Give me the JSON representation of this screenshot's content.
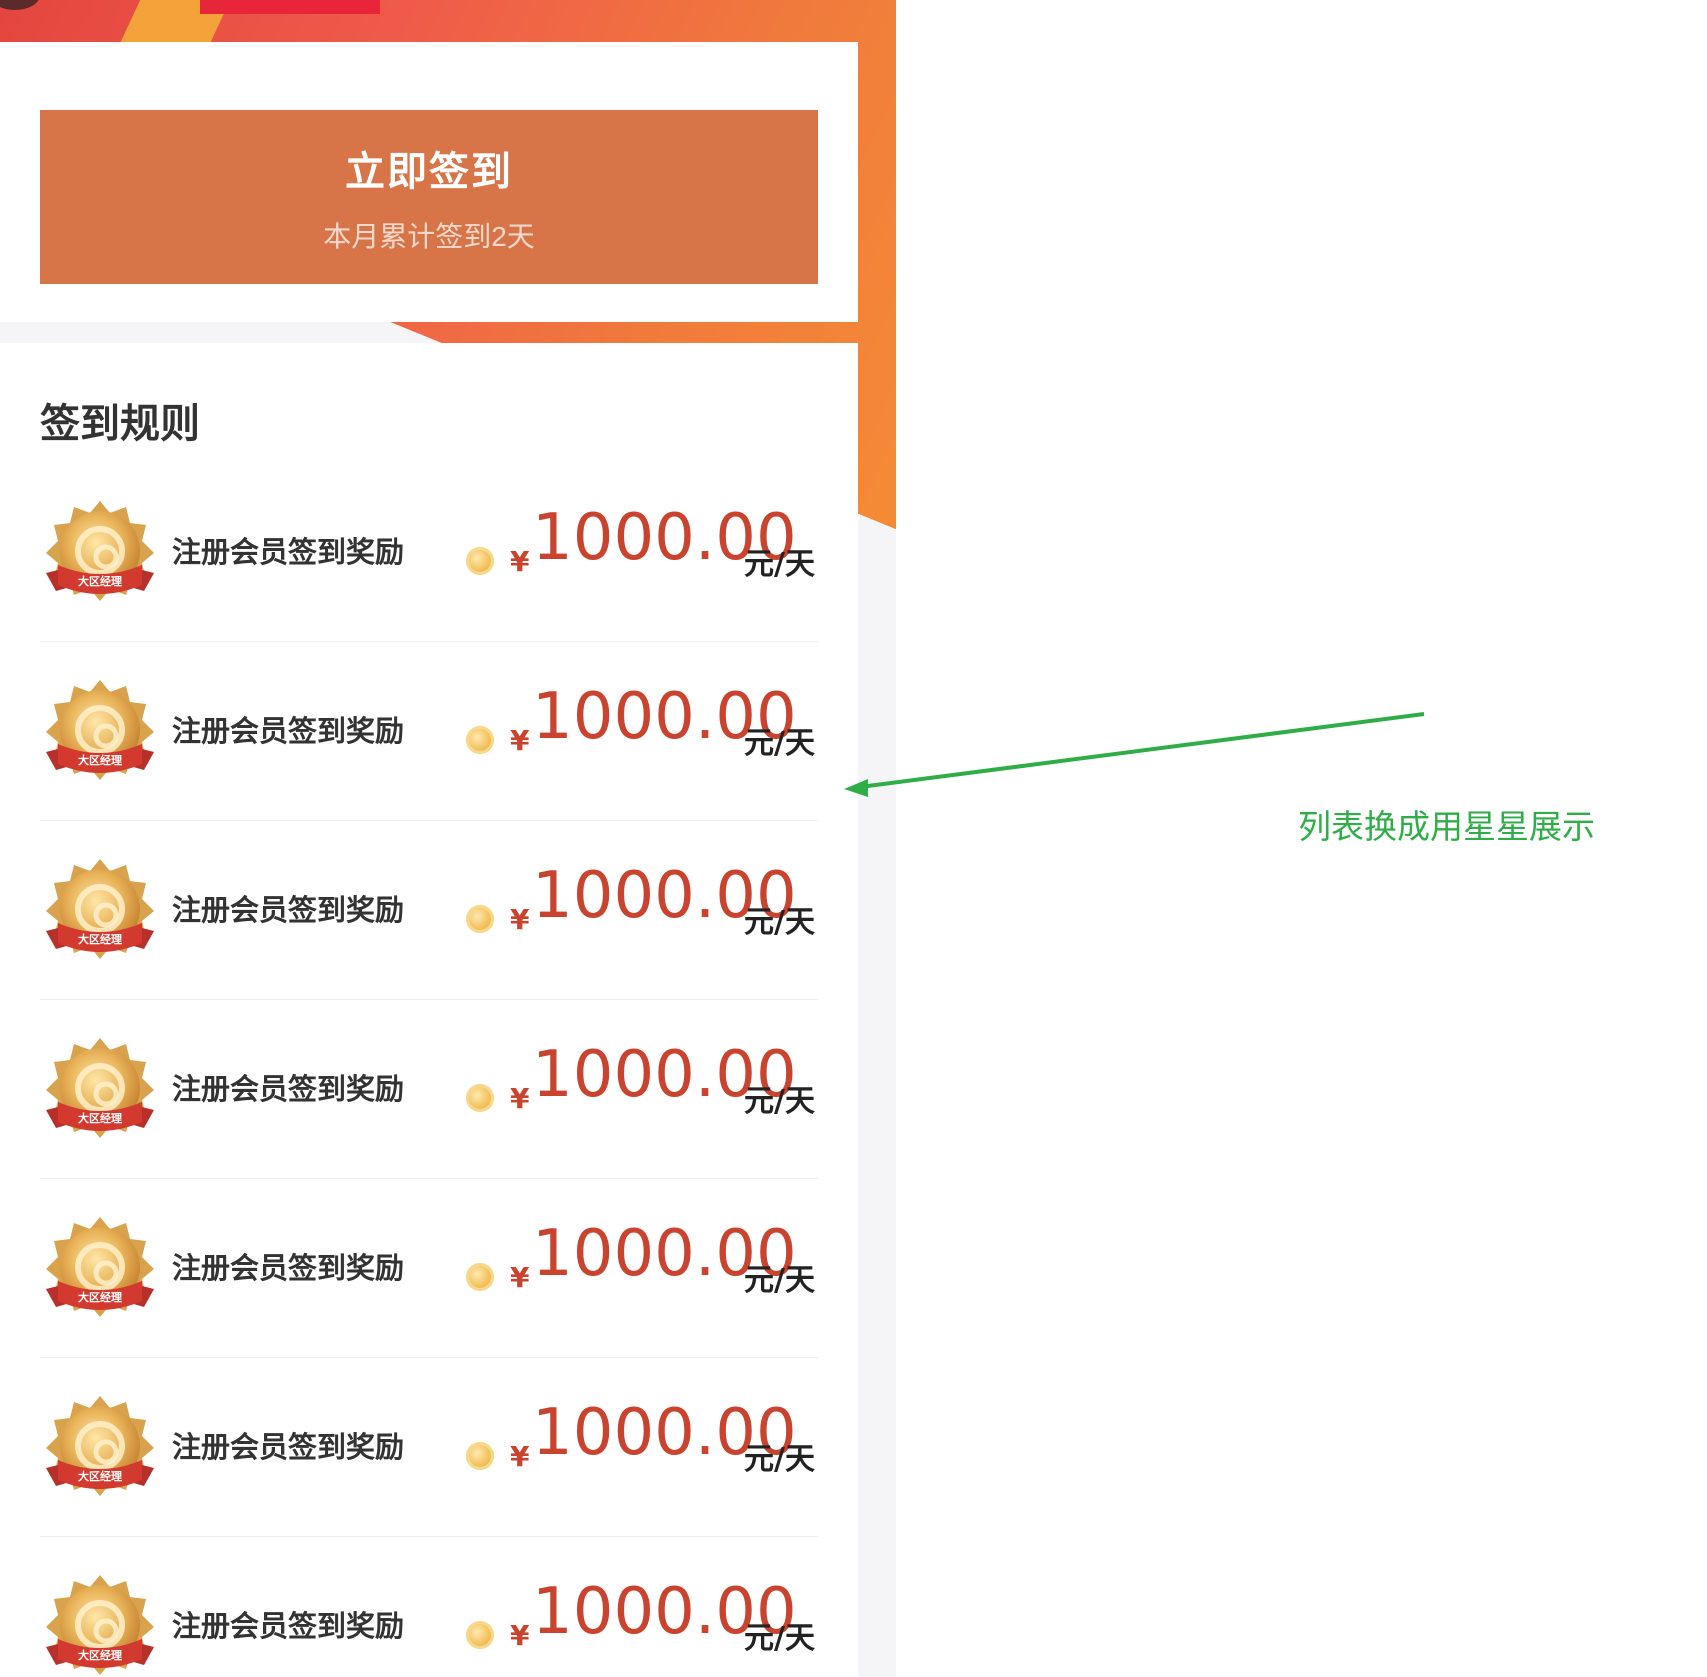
{
  "checkin": {
    "button_label": "立即签到",
    "monthly_status": "本月累计签到2天"
  },
  "rules": {
    "title": "签到规则",
    "items": [
      {
        "badge_text": "大区经理",
        "label": "注册会员签到奖励",
        "currency": "¥",
        "amount": "1000.00",
        "unit": "元/天"
      },
      {
        "badge_text": "大区经理",
        "label": "注册会员签到奖励",
        "currency": "¥",
        "amount": "1000.00",
        "unit": "元/天"
      },
      {
        "badge_text": "大区经理",
        "label": "注册会员签到奖励",
        "currency": "¥",
        "amount": "1000.00",
        "unit": "元/天"
      },
      {
        "badge_text": "大区经理",
        "label": "注册会员签到奖励",
        "currency": "¥",
        "amount": "1000.00",
        "unit": "元/天"
      },
      {
        "badge_text": "大区经理",
        "label": "注册会员签到奖励",
        "currency": "¥",
        "amount": "1000.00",
        "unit": "元/天"
      },
      {
        "badge_text": "大区经理",
        "label": "注册会员签到奖励",
        "currency": "¥",
        "amount": "1000.00",
        "unit": "元/天"
      },
      {
        "badge_text": "大区经理",
        "label": "注册会员签到奖励",
        "currency": "¥",
        "amount": "1000.00",
        "unit": "元/天"
      }
    ]
  },
  "annotation": {
    "note": "列表换成用星星展示",
    "color": "#2fae48"
  },
  "colors": {
    "checkin_button": "#d77549",
    "amount": "#c9432e",
    "hero_gradient_start": "#e4463f",
    "hero_gradient_end": "#f58b35"
  },
  "icons": {
    "badge": "medal-badge-icon",
    "coin": "coin-icon",
    "annotation_arrow": "arrow-left-icon"
  }
}
